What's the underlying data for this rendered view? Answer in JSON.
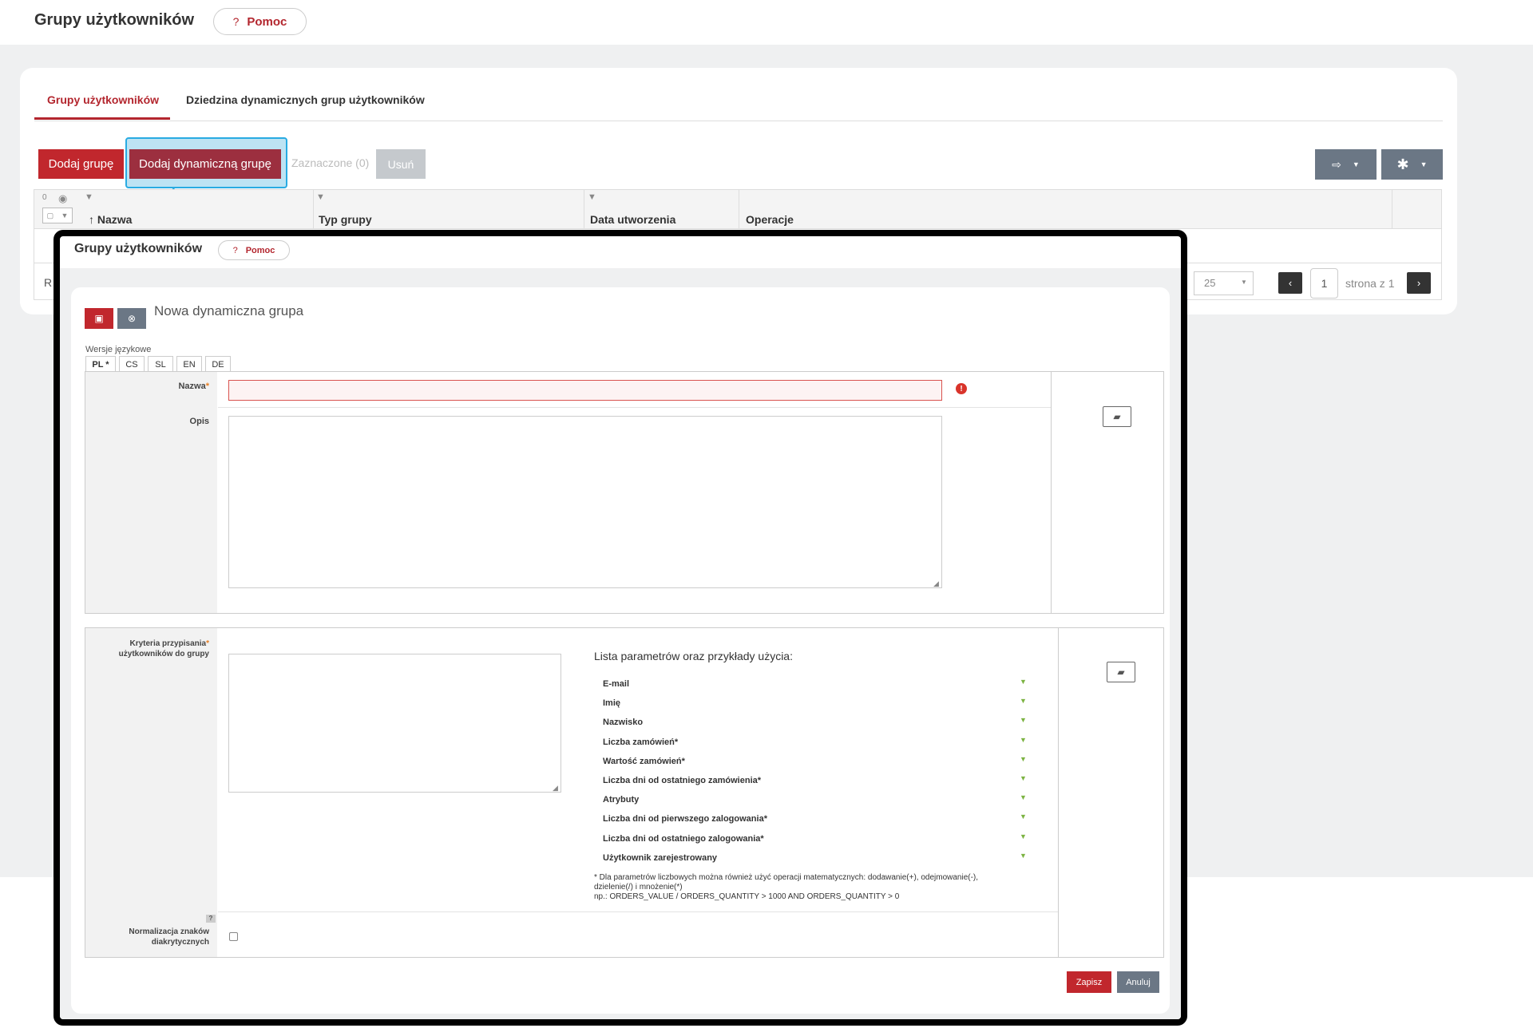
{
  "header": {
    "title": "Grupy użytkowników",
    "help_label": "Pomoc",
    "help_icon": "?"
  },
  "tabs": [
    {
      "label": "Grupy użytkowników",
      "active": true
    },
    {
      "label": "Dziedzina dynamicznych grup użytkowników",
      "active": false
    }
  ],
  "toolbar": {
    "add_group": "Dodaj grupę",
    "add_dynamic_group": "Dodaj dynamiczną grupę",
    "selected": "Zaznaczone (0)",
    "delete": "Usuń"
  },
  "table": {
    "visible_count": "0",
    "columns": [
      {
        "label": "Nazwa",
        "sort": "↑"
      },
      {
        "label": "Typ grupy"
      },
      {
        "label": "Data utworzenia"
      },
      {
        "label": "Operacje"
      }
    ],
    "row_fragment": "R"
  },
  "pagination": {
    "per_page": "25",
    "page": "1",
    "of_label": "strona z 1"
  },
  "dialog": {
    "title": "Grupy użytkowników",
    "help_label": "Pomoc",
    "help_icon": "?",
    "form_title": "Nowa dynamiczna grupa",
    "lang_versions_label": "Wersje językowe",
    "lang_tabs": [
      "PL *",
      "CS",
      "SL",
      "EN",
      "DE"
    ],
    "name_label": "Nazwa",
    "required_mark": "*",
    "error_icon": "!",
    "desc_label": "Opis",
    "criteria_label_1": "Kryteria przypisania",
    "criteria_label_2": "użytkowników do grupy",
    "params_title": "Lista parametrów oraz przykłady użycia:",
    "params": [
      "E-mail",
      "Imię",
      "Nazwisko",
      "Liczba zamówień*",
      "Wartość zamówień*",
      "Liczba dni od ostatniego zamówienia*",
      "Atrybuty",
      "Liczba dni od pierwszego zalogowania*",
      "Liczba dni od ostatniego zalogowania*",
      "Użytkownik zarejestrowany"
    ],
    "note_line1": "* Dla parametrów liczbowych można również użyć operacji matematycznych: dodawanie(+), odejmowanie(-),",
    "note_line2": "dzielenie(/) i mnożenie(*)",
    "note_line3": "np.: ORDERS_VALUE / ORDERS_QUANTITY > 1000 AND ORDERS_QUANTITY > 0",
    "normalization_label_1": "Normalizacja znaków",
    "normalization_label_2": "diakrytycznych",
    "hint_icon": "?",
    "save": "Zapisz",
    "cancel": "Anuluj"
  },
  "colors": {
    "brand_red": "#b3262e",
    "highlight": "#29abe2",
    "gray_button": "#6b7785"
  }
}
